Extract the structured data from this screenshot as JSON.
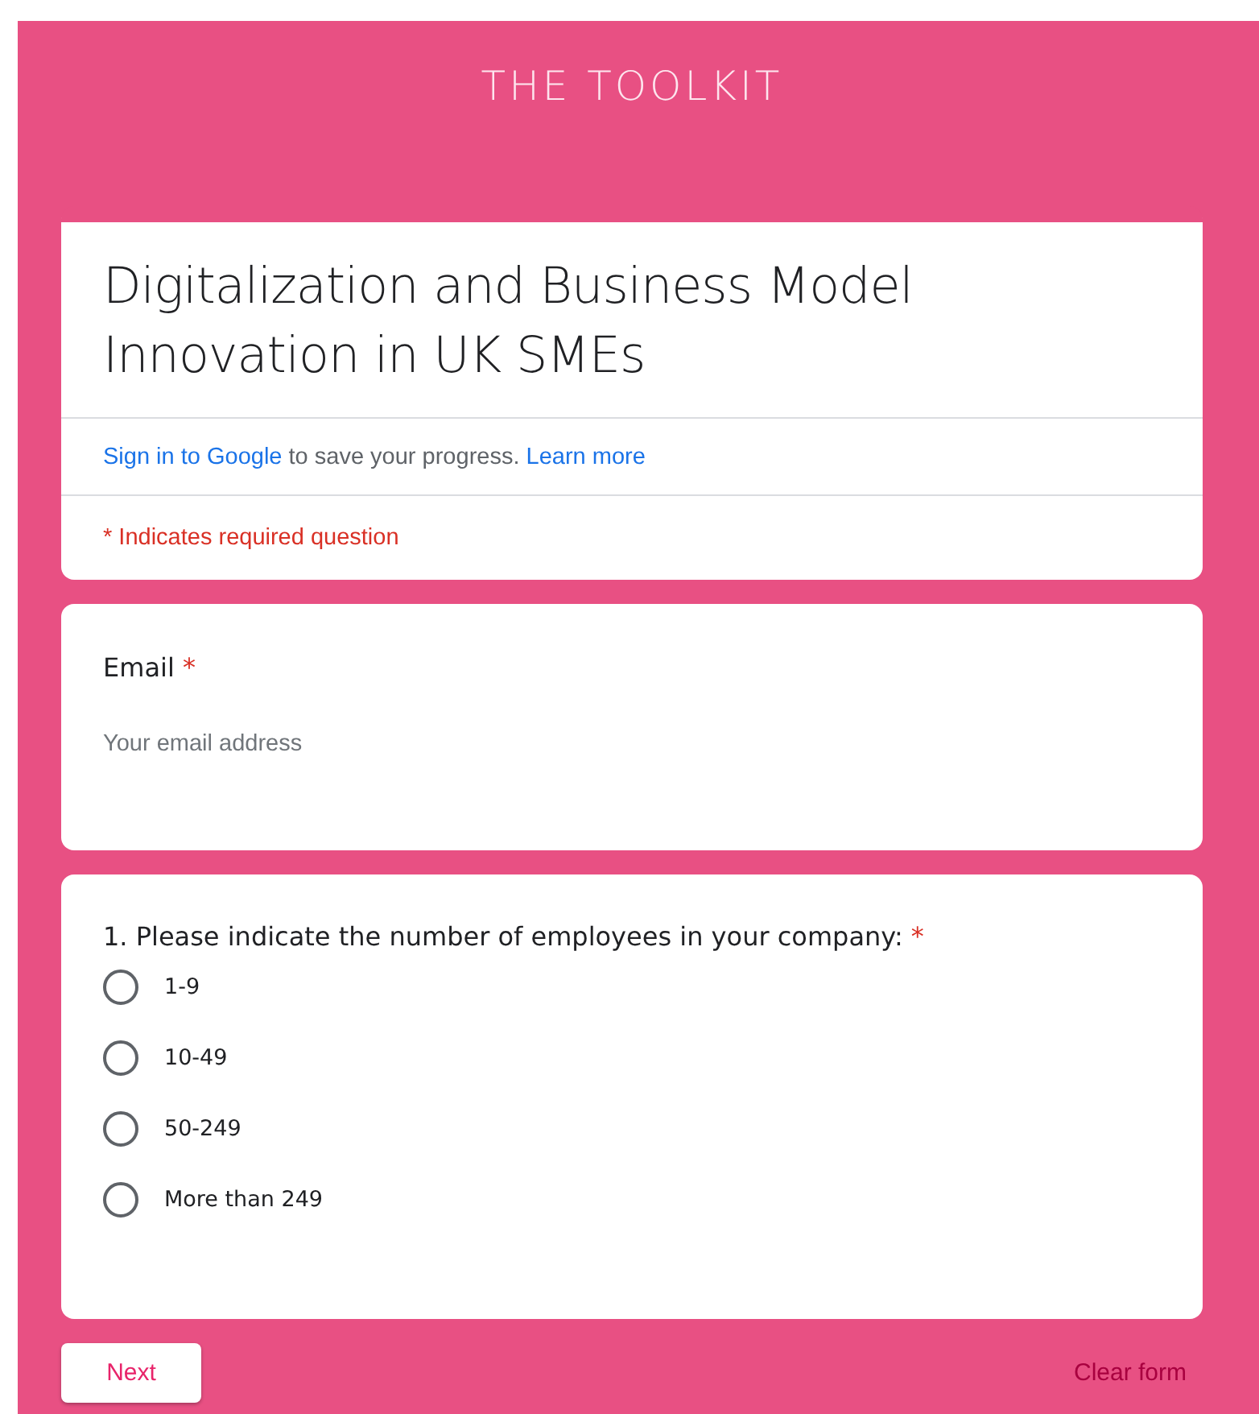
{
  "header": {
    "title": "THE TOOLKIT"
  },
  "form": {
    "title": "Digitalization and Business Model Innovation in UK SMEs",
    "signin_link": "Sign in to Google",
    "signin_text": " to save your progress. ",
    "learn_link": "Learn more",
    "required_note": "* Indicates required question"
  },
  "questions": [
    {
      "kind": "text",
      "label": "Email",
      "required_mark": "*",
      "placeholder": "Your email address"
    },
    {
      "kind": "radio",
      "label": "1. Please indicate the number of employees in your company: ",
      "required_mark": "*",
      "options": [
        {
          "label": "1-9",
          "selected": false
        },
        {
          "label": "10-49",
          "selected": false
        },
        {
          "label": "50-249",
          "selected": false
        },
        {
          "label": "More than 249",
          "selected": false
        }
      ]
    }
  ],
  "buttons": {
    "next": "Next",
    "clear": "Clear form"
  }
}
